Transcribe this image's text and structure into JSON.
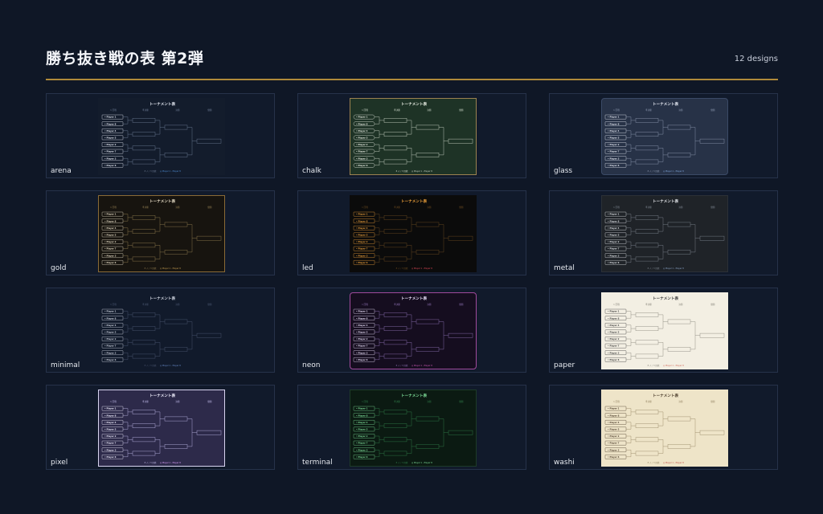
{
  "page": {
    "title": "勝ち抜き戦の表 第2弾",
    "count": "12 designs"
  },
  "thumbnail_text": {
    "heading": "トーナメント表",
    "col1": "1 回戦",
    "col2": "準決勝",
    "col3": "決勝",
    "col4": "優勝",
    "footer": "8 人 / 3 回戦",
    "footer_link": "Player 1 - Player 8",
    "players": [
      "Player 1",
      "Player 8",
      "Player 4",
      "Player 5",
      "Player 2",
      "Player 7",
      "Player 3",
      "Player 6"
    ]
  },
  "designs": [
    {
      "label": "arena",
      "bg": "#131c2c",
      "fg": "#e8ecf5",
      "line": "#6c7a93",
      "border": "#131c2c",
      "accent": "#4f8fd8"
    },
    {
      "label": "chalk",
      "bg": "#1e3326",
      "fg": "#eef2e8",
      "line": "#c9d3c4",
      "border": "#9c8250",
      "accent": "#c9d3c4"
    },
    {
      "label": "glass",
      "bg": "#273247",
      "fg": "#e8ecf5",
      "line": "#8a96ad",
      "border": "#3b4a66",
      "accent": "#7fa8de"
    },
    {
      "label": "gold",
      "bg": "#17140f",
      "fg": "#e9dfc8",
      "line": "#8e7a4e",
      "border": "#8a6a36",
      "accent": "#c8a052"
    },
    {
      "label": "led",
      "bg": "#0b0b0b",
      "fg": "#f0a23b",
      "line": "#6a4a20",
      "border": "#0b0b0b",
      "accent": "#e84a5a"
    },
    {
      "label": "metal",
      "bg": "#1f2328",
      "fg": "#e3e6ea",
      "line": "#7b838d",
      "border": "#2b3037",
      "accent": "#8aa4c8"
    },
    {
      "label": "minimal",
      "bg": "#111a2b",
      "fg": "#d6dbe6",
      "line": "#4a5670",
      "border": "#111a2b",
      "accent": "#6c8fd0"
    },
    {
      "label": "neon",
      "bg": "#150d1f",
      "fg": "#efe6ff",
      "line": "#8b6fb0",
      "border": "#a04a9c",
      "accent": "#d05ab8"
    },
    {
      "label": "paper",
      "bg": "#f3efe3",
      "fg": "#3a3a3a",
      "line": "#8d8a80",
      "border": "#f3efe3",
      "accent": "#d06a5a"
    },
    {
      "label": "pixel",
      "bg": "#2d2a4a",
      "fg": "#f2f0ff",
      "line": "#b8b2e0",
      "border": "#d8d4f0",
      "accent": "#e0a0ff"
    },
    {
      "label": "terminal",
      "bg": "#0b1a12",
      "fg": "#7fe09a",
      "line": "#2f7a48",
      "border": "#1d3b28",
      "accent": "#7fe09a"
    },
    {
      "label": "washi",
      "bg": "#eee4c8",
      "fg": "#4a3b2a",
      "line": "#9a8a6a",
      "border": "#eee4c8",
      "accent": "#c0504a"
    }
  ]
}
